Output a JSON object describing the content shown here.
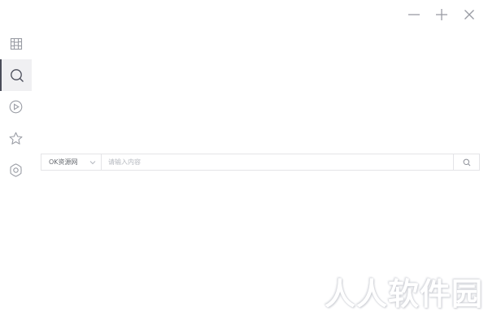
{
  "window_controls": {
    "minimize_icon": "minimize-icon",
    "maximize_icon": "plus-icon",
    "close_icon": "close-icon"
  },
  "sidebar": {
    "items": [
      {
        "icon": "film-grid-icon",
        "active": false
      },
      {
        "icon": "search-icon",
        "active": true
      },
      {
        "icon": "play-circle-icon",
        "active": false
      },
      {
        "icon": "star-icon",
        "active": false
      },
      {
        "icon": "gear-icon",
        "active": false
      }
    ]
  },
  "search": {
    "source_selected": "OK资源网",
    "input_value": "",
    "placeholder": "请输入内容"
  },
  "watermark": {
    "text": "人人软件园"
  },
  "colors": {
    "sidebar_active_bg": "#f0f0f2",
    "sidebar_active_bar": "#4a4d59",
    "icon": "#999ca4",
    "border": "#e4e4e7"
  }
}
